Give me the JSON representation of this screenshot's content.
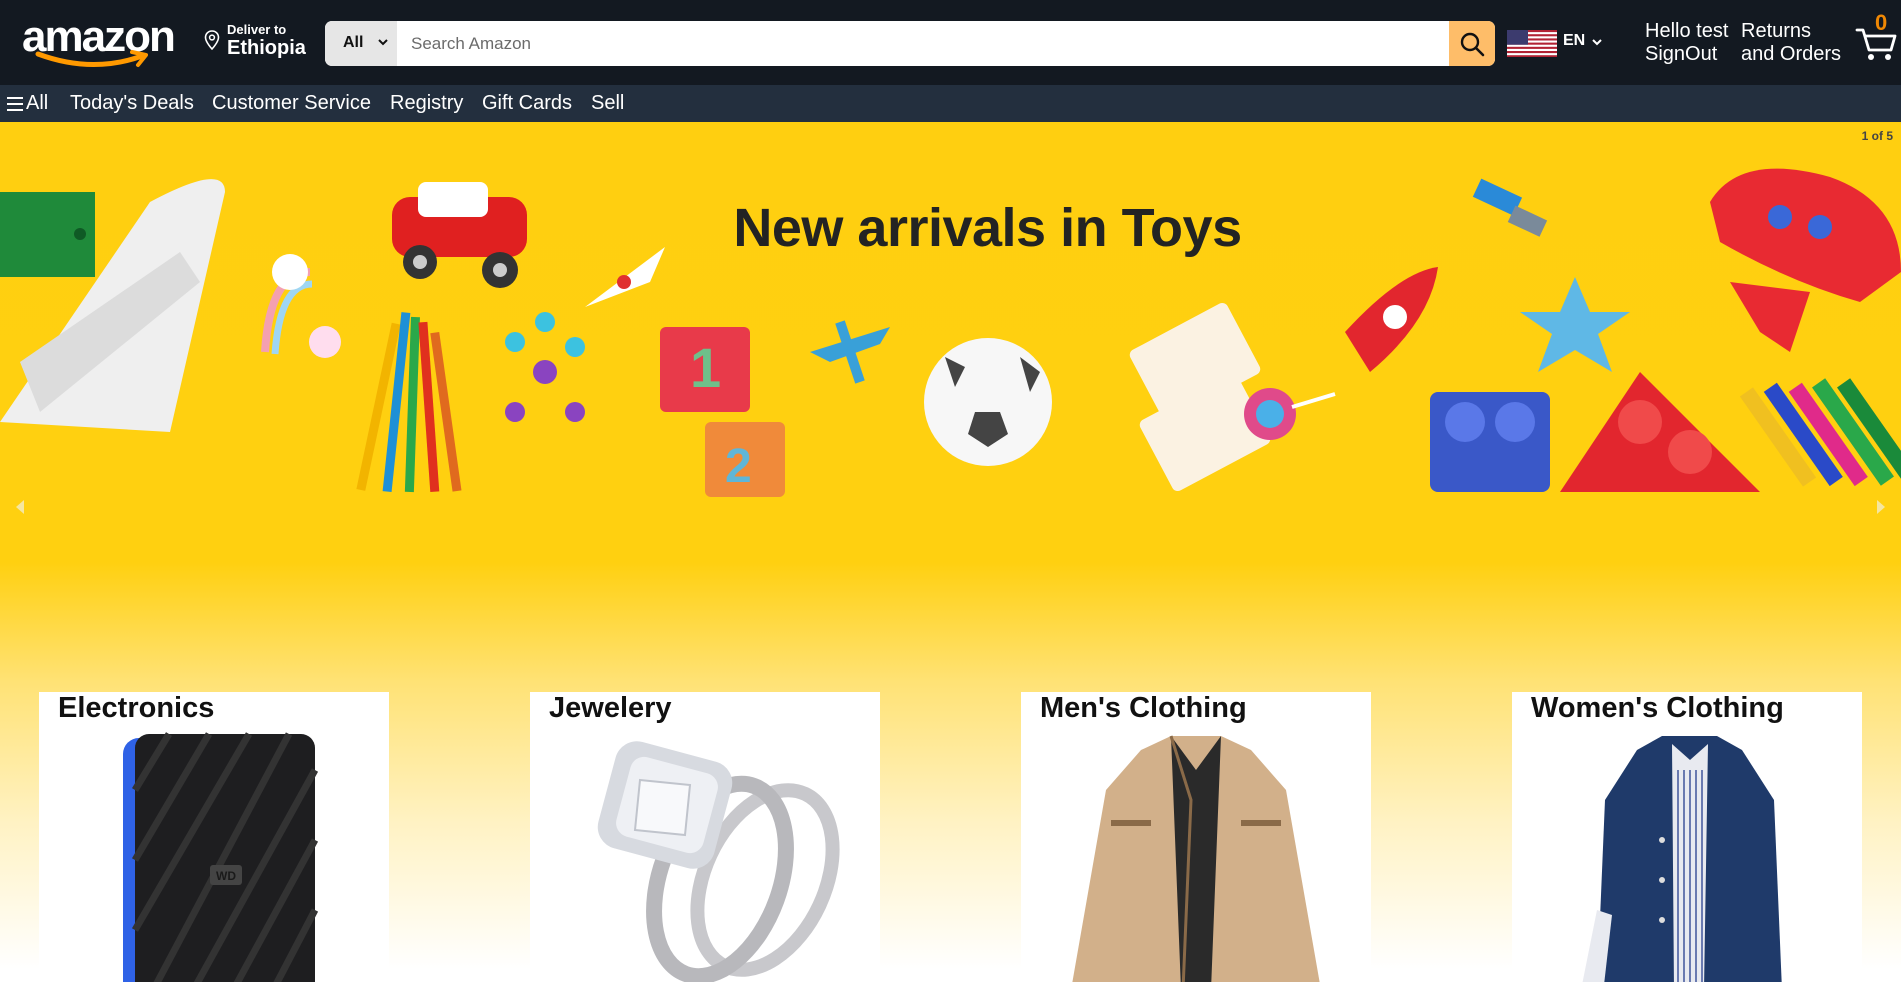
{
  "header": {
    "logo_text": "amazon",
    "deliver": {
      "label": "Deliver to",
      "location": "Ethiopia",
      "icon": "location-pin-icon"
    },
    "search": {
      "category": "All",
      "placeholder": "Search Amazon",
      "icon": "search-icon"
    },
    "language": {
      "code": "EN",
      "flag": "us-flag-icon"
    },
    "account": {
      "greeting": "Hello test",
      "signout": "SignOut"
    },
    "returns": {
      "line1": "Returns",
      "line2": "and Orders"
    },
    "cart": {
      "count": "0",
      "icon": "cart-icon"
    }
  },
  "nav": {
    "all_label": "All",
    "items": [
      "Today's Deals",
      "Customer Service",
      "Registry",
      "Gift Cards",
      "Sell"
    ]
  },
  "hero": {
    "title": "New arrivals in Toys",
    "counter": "1 of 5"
  },
  "categories": [
    {
      "title": "Electronics",
      "image": "external-hard-drive"
    },
    {
      "title": "Jewelery",
      "image": "diamond-ring"
    },
    {
      "title": "Men's Clothing",
      "image": "mens-jacket"
    },
    {
      "title": "Women's Clothing",
      "image": "womens-coat"
    }
  ],
  "colors": {
    "header_bg": "#131921",
    "nav_bg": "#232f3e",
    "search_button": "#febd69",
    "cart_count": "#f08804",
    "hero_yellow": "#ffcf10"
  }
}
